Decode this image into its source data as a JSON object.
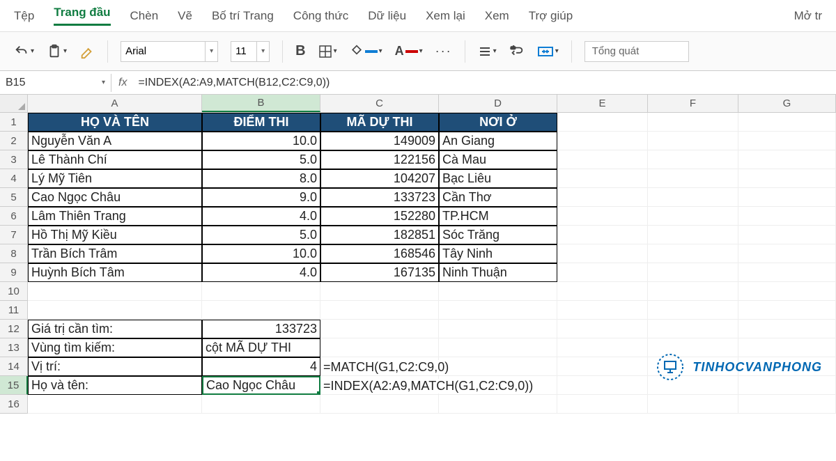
{
  "menu": {
    "file": "Tệp",
    "home": "Trang đầu",
    "insert": "Chèn",
    "draw": "Vẽ",
    "layout": "Bố trí Trang",
    "formulas": "Công thức",
    "data": "Dữ liệu",
    "review": "Xem lại",
    "view": "Xem",
    "help": "Trợ giúp",
    "open": "Mở tr"
  },
  "toolbar": {
    "font": "Arial",
    "size": "11",
    "general": "Tổng quát"
  },
  "namebox": "B15",
  "formula": "=INDEX(A2:A9,MATCH(B12,C2:C9,0))",
  "cols": [
    "A",
    "B",
    "C",
    "D",
    "E",
    "F",
    "G"
  ],
  "headers": {
    "A": "HỌ VÀ TÊN",
    "B": "ĐIỂM THI",
    "C": "MÃ DỰ THI",
    "D": "NƠI Ở"
  },
  "data": [
    {
      "A": "Nguyễn Văn A",
      "B": "10.0",
      "C": "149009",
      "D": "An Giang"
    },
    {
      "A": "Lê Thành Chí",
      "B": "5.0",
      "C": "122156",
      "D": "Cà Mau"
    },
    {
      "A": "Lý Mỹ Tiên",
      "B": "8.0",
      "C": "104207",
      "D": "Bạc Liêu"
    },
    {
      "A": "Cao Ngọc Châu",
      "B": "9.0",
      "C": "133723",
      "D": "Cần Thơ"
    },
    {
      "A": "Lâm Thiên Trang",
      "B": "4.0",
      "C": "152280",
      "D": "TP.HCM"
    },
    {
      "A": "Hồ Thị Mỹ Kiều",
      "B": "5.0",
      "C": "182851",
      "D": "Sóc Trăng"
    },
    {
      "A": "Trần Bích Trâm",
      "B": "10.0",
      "C": "168546",
      "D": "Tây Ninh"
    },
    {
      "A": "Huỳnh Bích Tâm",
      "B": "4.0",
      "C": "167135",
      "D": "Ninh Thuận"
    }
  ],
  "lookup": {
    "label12": "Giá trị cần tìm:",
    "val12": "133723",
    "label13": "Vùng tìm kiếm:",
    "val13": "cột MÃ DỰ THI",
    "label14": "Vị trí:",
    "val14": "4",
    "f14": "=MATCH(G1,C2:C9,0)",
    "label15": "Họ và tên:",
    "val15": "Cao Ngọc Châu",
    "f15": "=INDEX(A2:A9,MATCH(G1,C2:C9,0))"
  },
  "watermark": "TINHOCVANPHONG"
}
